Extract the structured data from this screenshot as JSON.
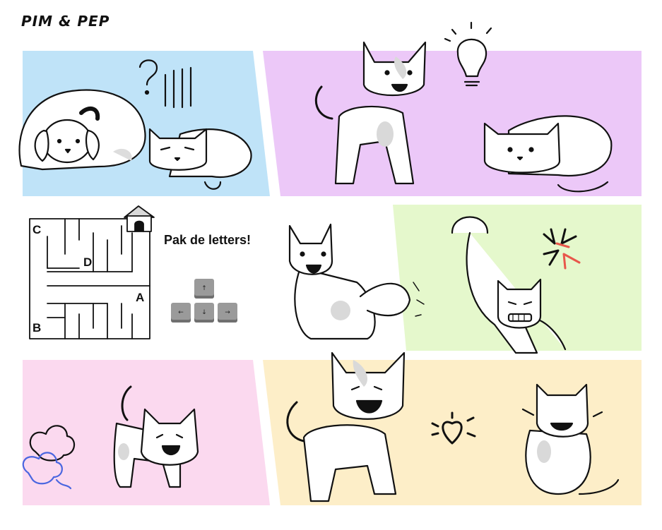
{
  "title": "PIM & PEP",
  "instruction": "Pak de letters!",
  "maze": {
    "letters": {
      "a": "A",
      "b": "B",
      "c": "C",
      "d": "D"
    }
  },
  "keys": {
    "up": "↑",
    "left": "←",
    "down": "↓",
    "right": "→"
  },
  "colors": {
    "panel_blue": "#bfe3f8",
    "panel_purple": "#ecc8f8",
    "panel_green": "#e5f8cc",
    "panel_pink": "#fbd9ef",
    "panel_yellow": "#fdeec8",
    "anger_red": "#e8574b",
    "cloud_blue": "#4a66e0",
    "fur_gray": "#d9d9d9"
  },
  "icons": [
    "question-mark-icon",
    "lightbulb-icon",
    "anger-icon",
    "heart-icon",
    "smell-cloud-icon",
    "doghouse-icon"
  ]
}
